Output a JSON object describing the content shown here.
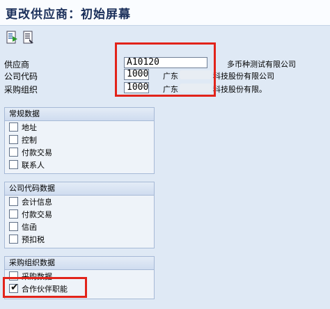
{
  "window": {
    "title": "更改供应商：初始屏幕"
  },
  "toolbar": {
    "buttons": [
      "execute-icon",
      "document-icon"
    ]
  },
  "fields": {
    "vendor": {
      "label": "供应商",
      "value": "A10120",
      "description": "多币种测试有限公司"
    },
    "company_code": {
      "label": "公司代码",
      "value": "1000",
      "description_prefix": "广东",
      "description_suffix": "科技股份有限公司"
    },
    "purch_org": {
      "label": "采购组织",
      "value": "1000",
      "description_prefix": "广东",
      "description_suffix": "科技股份有限。"
    }
  },
  "groups": {
    "general": {
      "title": "常规数据",
      "items": [
        {
          "label": "地址",
          "checked": false
        },
        {
          "label": "控制",
          "checked": false
        },
        {
          "label": "付款交易",
          "checked": false
        },
        {
          "label": "联系人",
          "checked": false
        }
      ]
    },
    "company": {
      "title": "公司代码数据",
      "items": [
        {
          "label": "会计信息",
          "checked": false
        },
        {
          "label": "付款交易",
          "checked": false
        },
        {
          "label": "信函",
          "checked": false
        },
        {
          "label": "预扣税",
          "checked": false
        }
      ]
    },
    "purchasing": {
      "title": "采购组织数据",
      "items": [
        {
          "label": "采购数据",
          "checked": false
        },
        {
          "label": "合作伙伴职能",
          "checked": true
        }
      ]
    }
  },
  "colors": {
    "highlight": "#e2231a",
    "background": "#dfe9f5"
  }
}
